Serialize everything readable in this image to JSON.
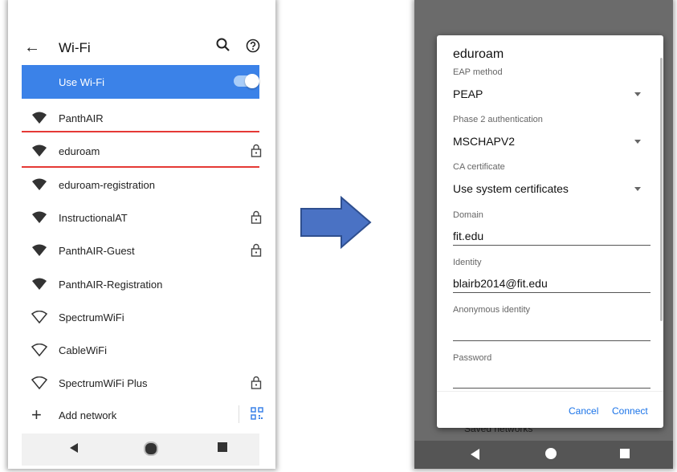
{
  "left": {
    "title": "Wi-Fi",
    "use_wifi_label": "Use Wi-Fi",
    "use_wifi_on": true,
    "networks": [
      {
        "name": "PanthAIR",
        "icon": "wifi-filled-icon",
        "locked": false
      },
      {
        "name": "eduroam",
        "icon": "wifi-filled-icon",
        "locked": true
      },
      {
        "name": "eduroam-registration",
        "icon": "wifi-filled-icon",
        "locked": false
      },
      {
        "name": "InstructionalAT",
        "icon": "wifi-filled-icon",
        "locked": true
      },
      {
        "name": "PanthAIR-Guest",
        "icon": "wifi-filled-icon",
        "locked": true
      },
      {
        "name": "PanthAIR-Registration",
        "icon": "wifi-filled-icon",
        "locked": false
      },
      {
        "name": "SpectrumWiFi",
        "icon": "wifi-outline-icon",
        "locked": false
      },
      {
        "name": "CableWiFi",
        "icon": "wifi-outline-icon",
        "locked": false
      },
      {
        "name": "SpectrumWiFi Plus",
        "icon": "wifi-outline-icon",
        "locked": true
      }
    ],
    "add_network_label": "Add network",
    "accent_color": "#3b82e8",
    "highlight_color": "#e53935"
  },
  "right": {
    "dialog_title": "eduroam",
    "fields": [
      {
        "label": "EAP method",
        "value": "PEAP",
        "type": "dropdown"
      },
      {
        "label": "Phase 2 authentication",
        "value": "MSCHAPV2",
        "type": "dropdown"
      },
      {
        "label": "CA certificate",
        "value": "Use system certificates",
        "type": "dropdown"
      },
      {
        "label": "Domain",
        "value": "fit.edu",
        "type": "text"
      },
      {
        "label": "Identity",
        "value": "blairb2014@fit.edu",
        "type": "text"
      },
      {
        "label": "Anonymous identity",
        "value": "",
        "type": "text"
      },
      {
        "label": "Password",
        "value": "",
        "type": "password"
      }
    ],
    "cancel_label": "Cancel",
    "connect_label": "Connect",
    "background_text": "Saved networks",
    "button_color": "#1a73e8"
  }
}
